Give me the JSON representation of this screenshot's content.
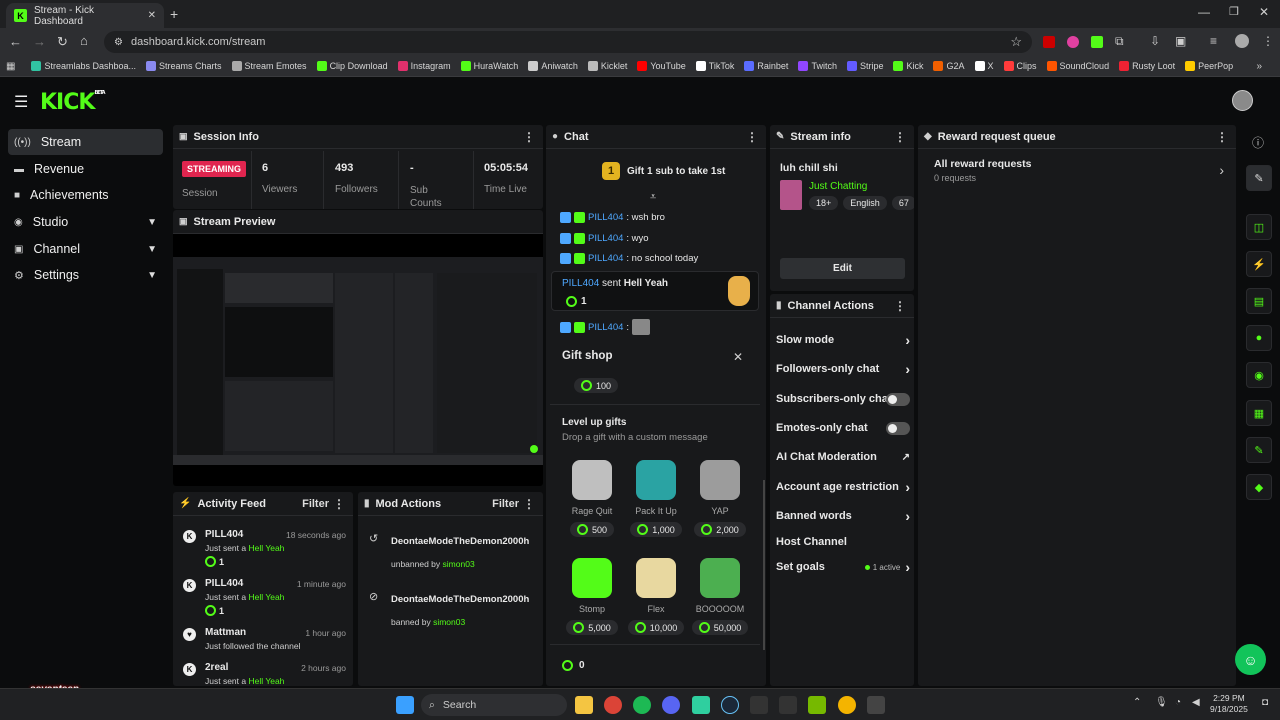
{
  "browser": {
    "tab_title": "Stream - Kick Dashboard",
    "url": "dashboard.kick.com/stream",
    "bookmarks": [
      {
        "label": "Streamlabs Dashboa...",
        "color": "#31c3a2"
      },
      {
        "label": "Streams Charts",
        "color": "#8a8af0"
      },
      {
        "label": "Stream Emotes",
        "color": "#aaaaaa"
      },
      {
        "label": "Clip Download",
        "color": "#53fc18"
      },
      {
        "label": "Instagram",
        "color": "#e1306c"
      },
      {
        "label": "HuraWatch",
        "color": "#53fc18"
      },
      {
        "label": "Aniwatch",
        "color": "#cccccc"
      },
      {
        "label": "Kicklet",
        "color": "#bbbbbb"
      },
      {
        "label": "YouTube",
        "color": "#ff0000"
      },
      {
        "label": "TikTok",
        "color": "#ffffff"
      },
      {
        "label": "Rainbet",
        "color": "#5a6cff"
      },
      {
        "label": "Twitch",
        "color": "#9146ff"
      },
      {
        "label": "Stripe",
        "color": "#635bff"
      },
      {
        "label": "Kick",
        "color": "#53fc18"
      },
      {
        "label": "G2A",
        "color": "#f05f00"
      },
      {
        "label": "X",
        "color": "#ffffff"
      },
      {
        "label": "Clips",
        "color": "#ff3b3b"
      },
      {
        "label": "SoundCloud",
        "color": "#ff5500"
      },
      {
        "label": "Rusty Loot",
        "color": "#e23"
      },
      {
        "label": "PeerPop",
        "color": "#ffcc00"
      }
    ]
  },
  "app": {
    "logo": "KICK",
    "logo_badge": "BETA"
  },
  "sidebar": {
    "items": [
      {
        "label": "Stream",
        "icon": "broadcast-icon"
      },
      {
        "label": "Revenue",
        "icon": "revenue-icon"
      },
      {
        "label": "Achievements",
        "icon": "achievements-icon"
      },
      {
        "label": "Studio",
        "icon": "studio-icon"
      },
      {
        "label": "Channel",
        "icon": "channel-icon"
      },
      {
        "label": "Settings",
        "icon": "gear-icon"
      }
    ]
  },
  "session": {
    "title": "Session Info",
    "status": "STREAMING",
    "status_label": "Session",
    "viewers_value": "6",
    "viewers_label": "Viewers",
    "followers_value": "493",
    "followers_label": "Followers",
    "subs_value": "-",
    "subs_label": "Sub Counts",
    "time_value": "05:05:54",
    "time_label": "Time Live"
  },
  "preview": {
    "title": "Stream Preview"
  },
  "activity": {
    "title": "Activity Feed",
    "filter": "Filter",
    "items": [
      {
        "user": "PILL404",
        "time": "18 seconds ago",
        "text": "Just sent a",
        "gift": "Hell Yeah",
        "count": "1"
      },
      {
        "user": "PILL404",
        "time": "1 minute ago",
        "text": "Just sent a",
        "gift": "Hell Yeah",
        "count": "1"
      },
      {
        "user": "Mattman",
        "time": "1 hour ago",
        "text": "Just followed the channel"
      },
      {
        "user": "2real",
        "time": "2 hours ago",
        "text": "Just sent a",
        "gift": "Hell Yeah"
      }
    ]
  },
  "mod_actions": {
    "title": "Mod Actions",
    "filter": "Filter",
    "items": [
      {
        "user": "DeontaeModeTheDemon2000h",
        "action": "unbanned by",
        "mod": "simon03"
      },
      {
        "user": "DeontaeModeTheDemon2000h",
        "action": "banned by",
        "mod": "simon03"
      }
    ]
  },
  "chat": {
    "title": "Chat",
    "gift_rank": "1",
    "gift_banner": "Gift 1 sub to take 1st",
    "messages": [
      {
        "user": "PILL404",
        "text": ": wsh bro"
      },
      {
        "user": "PILL404",
        "text": ": wyo"
      },
      {
        "user": "PILL404",
        "text": ": no school today"
      }
    ],
    "gift_event": {
      "user": "PILL404",
      "verb": "sent",
      "gift": "Hell Yeah",
      "count": "1"
    },
    "last_user": "PILL404",
    "last_sep": ":"
  },
  "gift_shop": {
    "title": "Gift shop",
    "top_price": "100",
    "section_title": "Level up gifts",
    "section_sub": "Drop a gift with a custom message",
    "gifts": [
      {
        "name": "Rage Quit",
        "price": "500",
        "color": "#bfbfbf"
      },
      {
        "name": "Pack It Up",
        "price": "1,000",
        "color": "#2aa3a3"
      },
      {
        "name": "YAP",
        "price": "2,000",
        "color": "#9c9c9c"
      },
      {
        "name": "Stomp",
        "price": "5,000",
        "color": "#53fc18"
      },
      {
        "name": "Flex",
        "price": "10,000",
        "color": "#e8d8a0"
      },
      {
        "name": "BOOOOOM",
        "price": "50,000",
        "color": "#4caf50"
      }
    ],
    "balance": "0"
  },
  "stream_info": {
    "title": "Stream info",
    "stream_title": "luh chill shi",
    "category": "Just Chatting",
    "tags": [
      "18+",
      "English",
      "67"
    ],
    "edit": "Edit"
  },
  "channel_actions": {
    "title": "Channel Actions",
    "rows": [
      {
        "label": "Slow mode",
        "type": "chevron"
      },
      {
        "label": "Followers-only chat",
        "type": "chevron"
      },
      {
        "label": "Subscribers-only chat",
        "type": "toggle"
      },
      {
        "label": "Emotes-only chat",
        "type": "toggle"
      },
      {
        "label": "AI Chat Moderation",
        "type": "external"
      },
      {
        "label": "Account age restriction",
        "type": "chevron"
      },
      {
        "label": "Banned words",
        "type": "chevron"
      },
      {
        "label": "Host Channel",
        "type": "none"
      },
      {
        "label": "Set goals",
        "type": "chevron",
        "status": "1 active"
      }
    ]
  },
  "rewards": {
    "title": "Reward request queue",
    "all_label": "All reward requests",
    "count": "0 requests"
  },
  "taskbar": {
    "search": "Search",
    "time": "2:29 PM",
    "date": "9/18/2025"
  },
  "watermark": "seventeen",
  "colors": {
    "brand": "#53fc18",
    "streaming": "#e0254f",
    "username": "#4ea8ff"
  }
}
